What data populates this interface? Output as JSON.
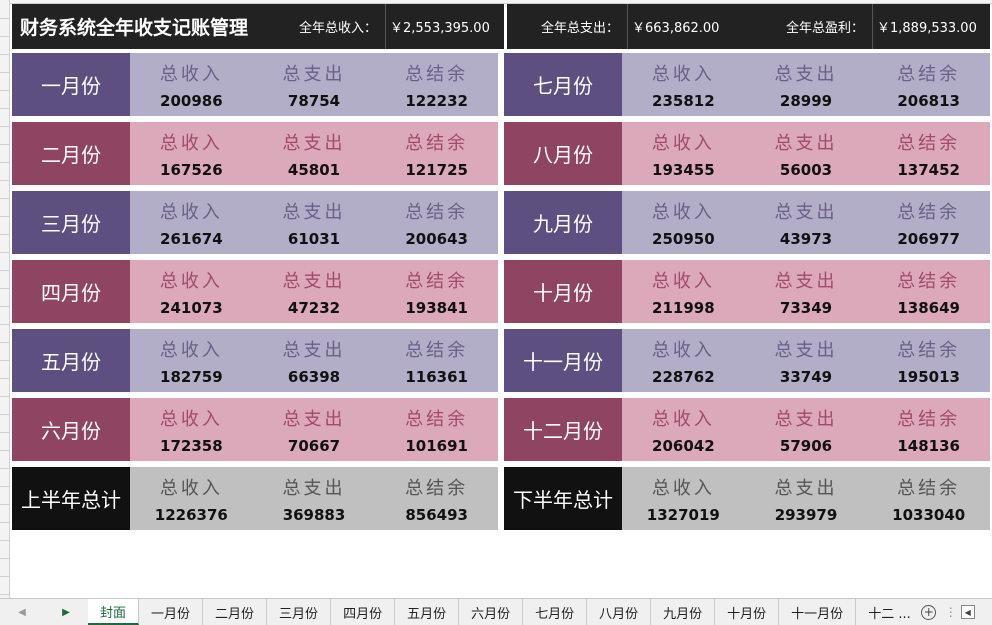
{
  "header": {
    "title": "财务系统全年收支记账管理",
    "income_label": "全年总收入：",
    "income_value": "￥2,553,395.00",
    "expense_label": "全年总支出：",
    "expense_value": "￥663,862.00",
    "profit_label": "全年总盈利：",
    "profit_value": "￥1,889,533.00"
  },
  "labels": {
    "income": "总收入",
    "expense": "总支出",
    "balance": "总结余"
  },
  "left": [
    {
      "month": "一月份",
      "income": "200986",
      "expense": "78754",
      "balance": "122232"
    },
    {
      "month": "二月份",
      "income": "167526",
      "expense": "45801",
      "balance": "121725"
    },
    {
      "month": "三月份",
      "income": "261674",
      "expense": "61031",
      "balance": "200643"
    },
    {
      "month": "四月份",
      "income": "241073",
      "expense": "47232",
      "balance": "193841"
    },
    {
      "month": "五月份",
      "income": "182759",
      "expense": "66398",
      "balance": "116361"
    },
    {
      "month": "六月份",
      "income": "172358",
      "expense": "70667",
      "balance": "101691"
    },
    {
      "month": "上半年总计",
      "income": "1226376",
      "expense": "369883",
      "balance": "856493"
    }
  ],
  "right": [
    {
      "month": "七月份",
      "income": "235812",
      "expense": "28999",
      "balance": "206813"
    },
    {
      "month": "八月份",
      "income": "193455",
      "expense": "56003",
      "balance": "137452"
    },
    {
      "month": "九月份",
      "income": "250950",
      "expense": "43973",
      "balance": "206977"
    },
    {
      "month": "十月份",
      "income": "211998",
      "expense": "73349",
      "balance": "138649"
    },
    {
      "month": "十一月份",
      "income": "228762",
      "expense": "33749",
      "balance": "195013"
    },
    {
      "month": "十二月份",
      "income": "206042",
      "expense": "57906",
      "balance": "148136"
    },
    {
      "month": "下半年总计",
      "income": "1327019",
      "expense": "293979",
      "balance": "1033040"
    }
  ],
  "sheet_tabs": [
    "封面",
    "一月份",
    "二月份",
    "三月份",
    "四月份",
    "五月份",
    "六月份",
    "七月份",
    "八月份",
    "九月份",
    "十月份",
    "十一月份",
    "十二 ..."
  ],
  "active_tab": "封面",
  "icons": {
    "prev": "triangle-left-icon",
    "next": "triangle-right-icon",
    "add": "plus-circle-icon",
    "more": "vertical-dots-icon",
    "scroll_left": "scroll-left-icon"
  },
  "glyphs": {
    "prev": "◀",
    "next": "▶",
    "add": "+",
    "more": "⋮",
    "scroll_left": "◀"
  },
  "colors": {
    "purple_month": "#5d5080",
    "purple_cells": "#b3aec8",
    "rose_month": "#8f4462",
    "rose_cells": "#dba9ba",
    "total_month": "#111111",
    "total_cells": "#c0c0c0",
    "header_bg": "#222222",
    "active_tab": "#1e6b3a"
  }
}
